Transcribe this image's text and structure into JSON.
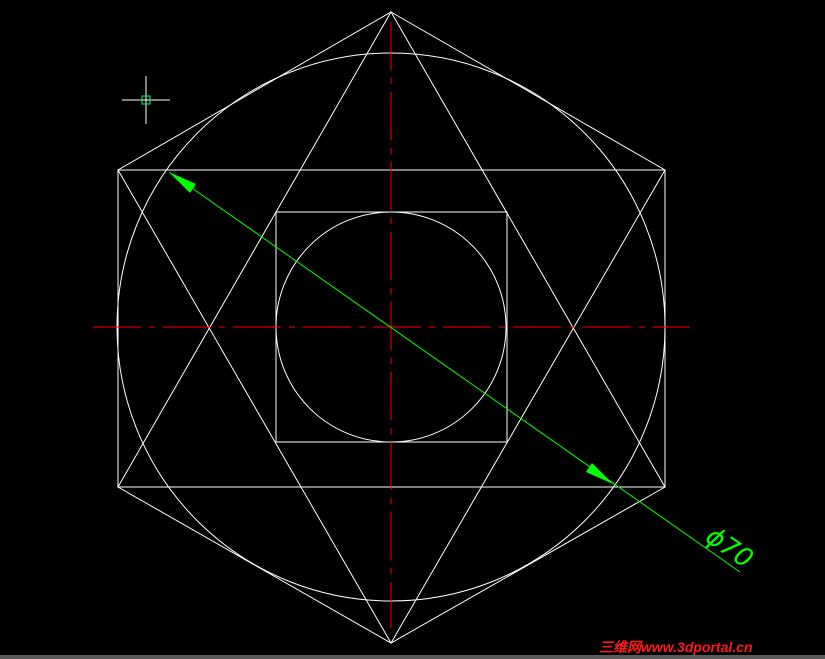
{
  "drawing": {
    "dimension_label": "ϕ70",
    "colors": {
      "background": "#000000",
      "geometry": "#ffffff",
      "centerline": "#ff0000",
      "dimension": "#00ff00",
      "cursor": "#ffffff",
      "watermark": "#ff1a1a"
    }
  },
  "watermark": {
    "text": "三维网www.3dportal.cn"
  }
}
